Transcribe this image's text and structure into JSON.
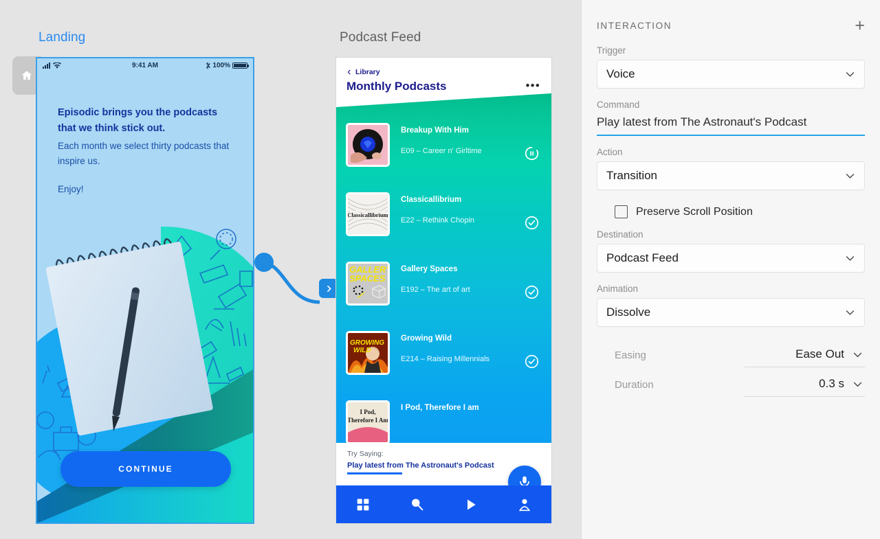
{
  "canvas": {
    "artboards": [
      {
        "name": "Landing",
        "label": "Landing",
        "selected": true
      },
      {
        "name": "Podcast Feed",
        "label": "Podcast Feed",
        "selected": false
      }
    ],
    "home_tab_icon": "home-icon",
    "connector": {
      "from": "Landing",
      "to": "Podcast Feed",
      "arrow_icon": "chevron-right-icon"
    }
  },
  "landing": {
    "statusbar": {
      "signal_icon": "cellular-signal-icon",
      "wifi_icon": "wifi-icon",
      "time": "9:41 AM",
      "bluetooth_icon": "bluetooth-icon",
      "battery_percent": "100%",
      "battery_icon": "battery-full-icon"
    },
    "headline": "Episodic brings you the podcasts that we think stick out.",
    "subtext": "Each month we select thirty podcasts that inspire us.",
    "closing": "Enjoy!",
    "continue_label": "CONTINUE"
  },
  "feed": {
    "back_label": "Library",
    "back_icon": "chevron-left-icon",
    "title": "Monthly Podcasts",
    "more_icon": "more-horizontal-icon",
    "items": [
      {
        "title": "Breakup With Him",
        "episode": "E09 – Career n' Girltime",
        "status_icon": "pause-progress-icon",
        "cover": "breakup-with-him-cover"
      },
      {
        "title": "Classicallibrium",
        "episode": "E22 – Rethink Chopin",
        "status_icon": "check-circle-icon",
        "cover": "classicallibrium-cover"
      },
      {
        "title": "Gallery Spaces",
        "episode": "E192 – The art of art",
        "status_icon": "check-circle-icon",
        "cover": "gallery-spaces-cover"
      },
      {
        "title": "Growing Wild",
        "episode": "E214 – Raising Millennials",
        "status_icon": "check-circle-icon",
        "cover": "growing-wild-cover"
      },
      {
        "title": "I Pod, Therefore I am",
        "episode": "",
        "status_icon": "",
        "cover": "i-pod-therefore-i-am-cover"
      }
    ],
    "try_saying_label": "Try Saying:",
    "try_saying_command": "Play latest from The Astronaut's Podcast",
    "mic_icon": "microphone-icon",
    "tabs": [
      {
        "name": "grid",
        "icon": "grid-icon"
      },
      {
        "name": "search",
        "icon": "search-icon"
      },
      {
        "name": "play",
        "icon": "play-icon"
      },
      {
        "name": "profile",
        "icon": "person-icon"
      }
    ]
  },
  "panel": {
    "title": "INTERACTION",
    "add_icon": "plus-icon",
    "trigger": {
      "label": "Trigger",
      "value": "Voice"
    },
    "command": {
      "label": "Command",
      "value": "Play latest from The Astronaut's Podcast"
    },
    "action": {
      "label": "Action",
      "value": "Transition"
    },
    "preserve_scroll": {
      "label": "Preserve Scroll Position",
      "checked": false
    },
    "destination": {
      "label": "Destination",
      "value": "Podcast Feed"
    },
    "animation": {
      "label": "Animation",
      "value": "Dissolve"
    },
    "easing": {
      "label": "Easing",
      "value": "Ease Out"
    },
    "duration": {
      "label": "Duration",
      "value": "0.3 s"
    }
  },
  "colors": {
    "accent_blue": "#1169f2",
    "selected_label": "#2a8af0",
    "command_underline": "#25a4e8",
    "canvas_bg": "#e4e4e4",
    "panel_bg": "#f6f6f6"
  }
}
